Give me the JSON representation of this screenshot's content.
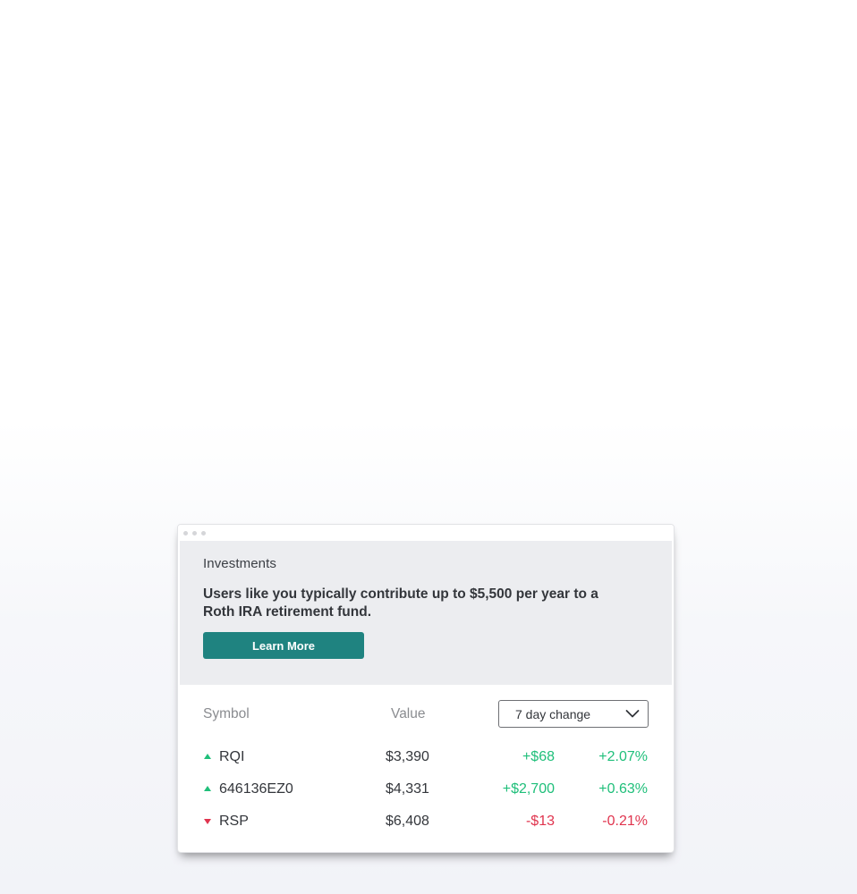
{
  "window": {
    "controls": [
      "dot",
      "dot",
      "dot"
    ]
  },
  "promo": {
    "label": "Investments",
    "message": "Users like you typically contribute up to $5,500 per year to a Roth IRA retirement fund.",
    "button_label": "Learn More",
    "button_color": "#1f8380"
  },
  "table": {
    "headers": {
      "symbol": "Symbol",
      "value": "Value"
    },
    "period_select": {
      "selected": "7 day change",
      "icon": "chevron-down-icon"
    },
    "rows": [
      {
        "symbol": "RQI",
        "value": "$3,390",
        "change": "+$68",
        "percent": "+2.07%",
        "direction": "up",
        "trend_icon": "triangle-up-icon"
      },
      {
        "symbol": "646136EZ0",
        "value": "$4,331",
        "change": "+$2,700",
        "percent": "+0.63%",
        "direction": "up",
        "trend_icon": "triangle-up-icon"
      },
      {
        "symbol": "RSP",
        "value": "$6,408",
        "change": "-$13",
        "percent": "-0.21%",
        "direction": "down",
        "trend_icon": "triangle-down-icon"
      }
    ],
    "colors": {
      "positive": "#1fbf7a",
      "negative": "#e0344e"
    }
  }
}
